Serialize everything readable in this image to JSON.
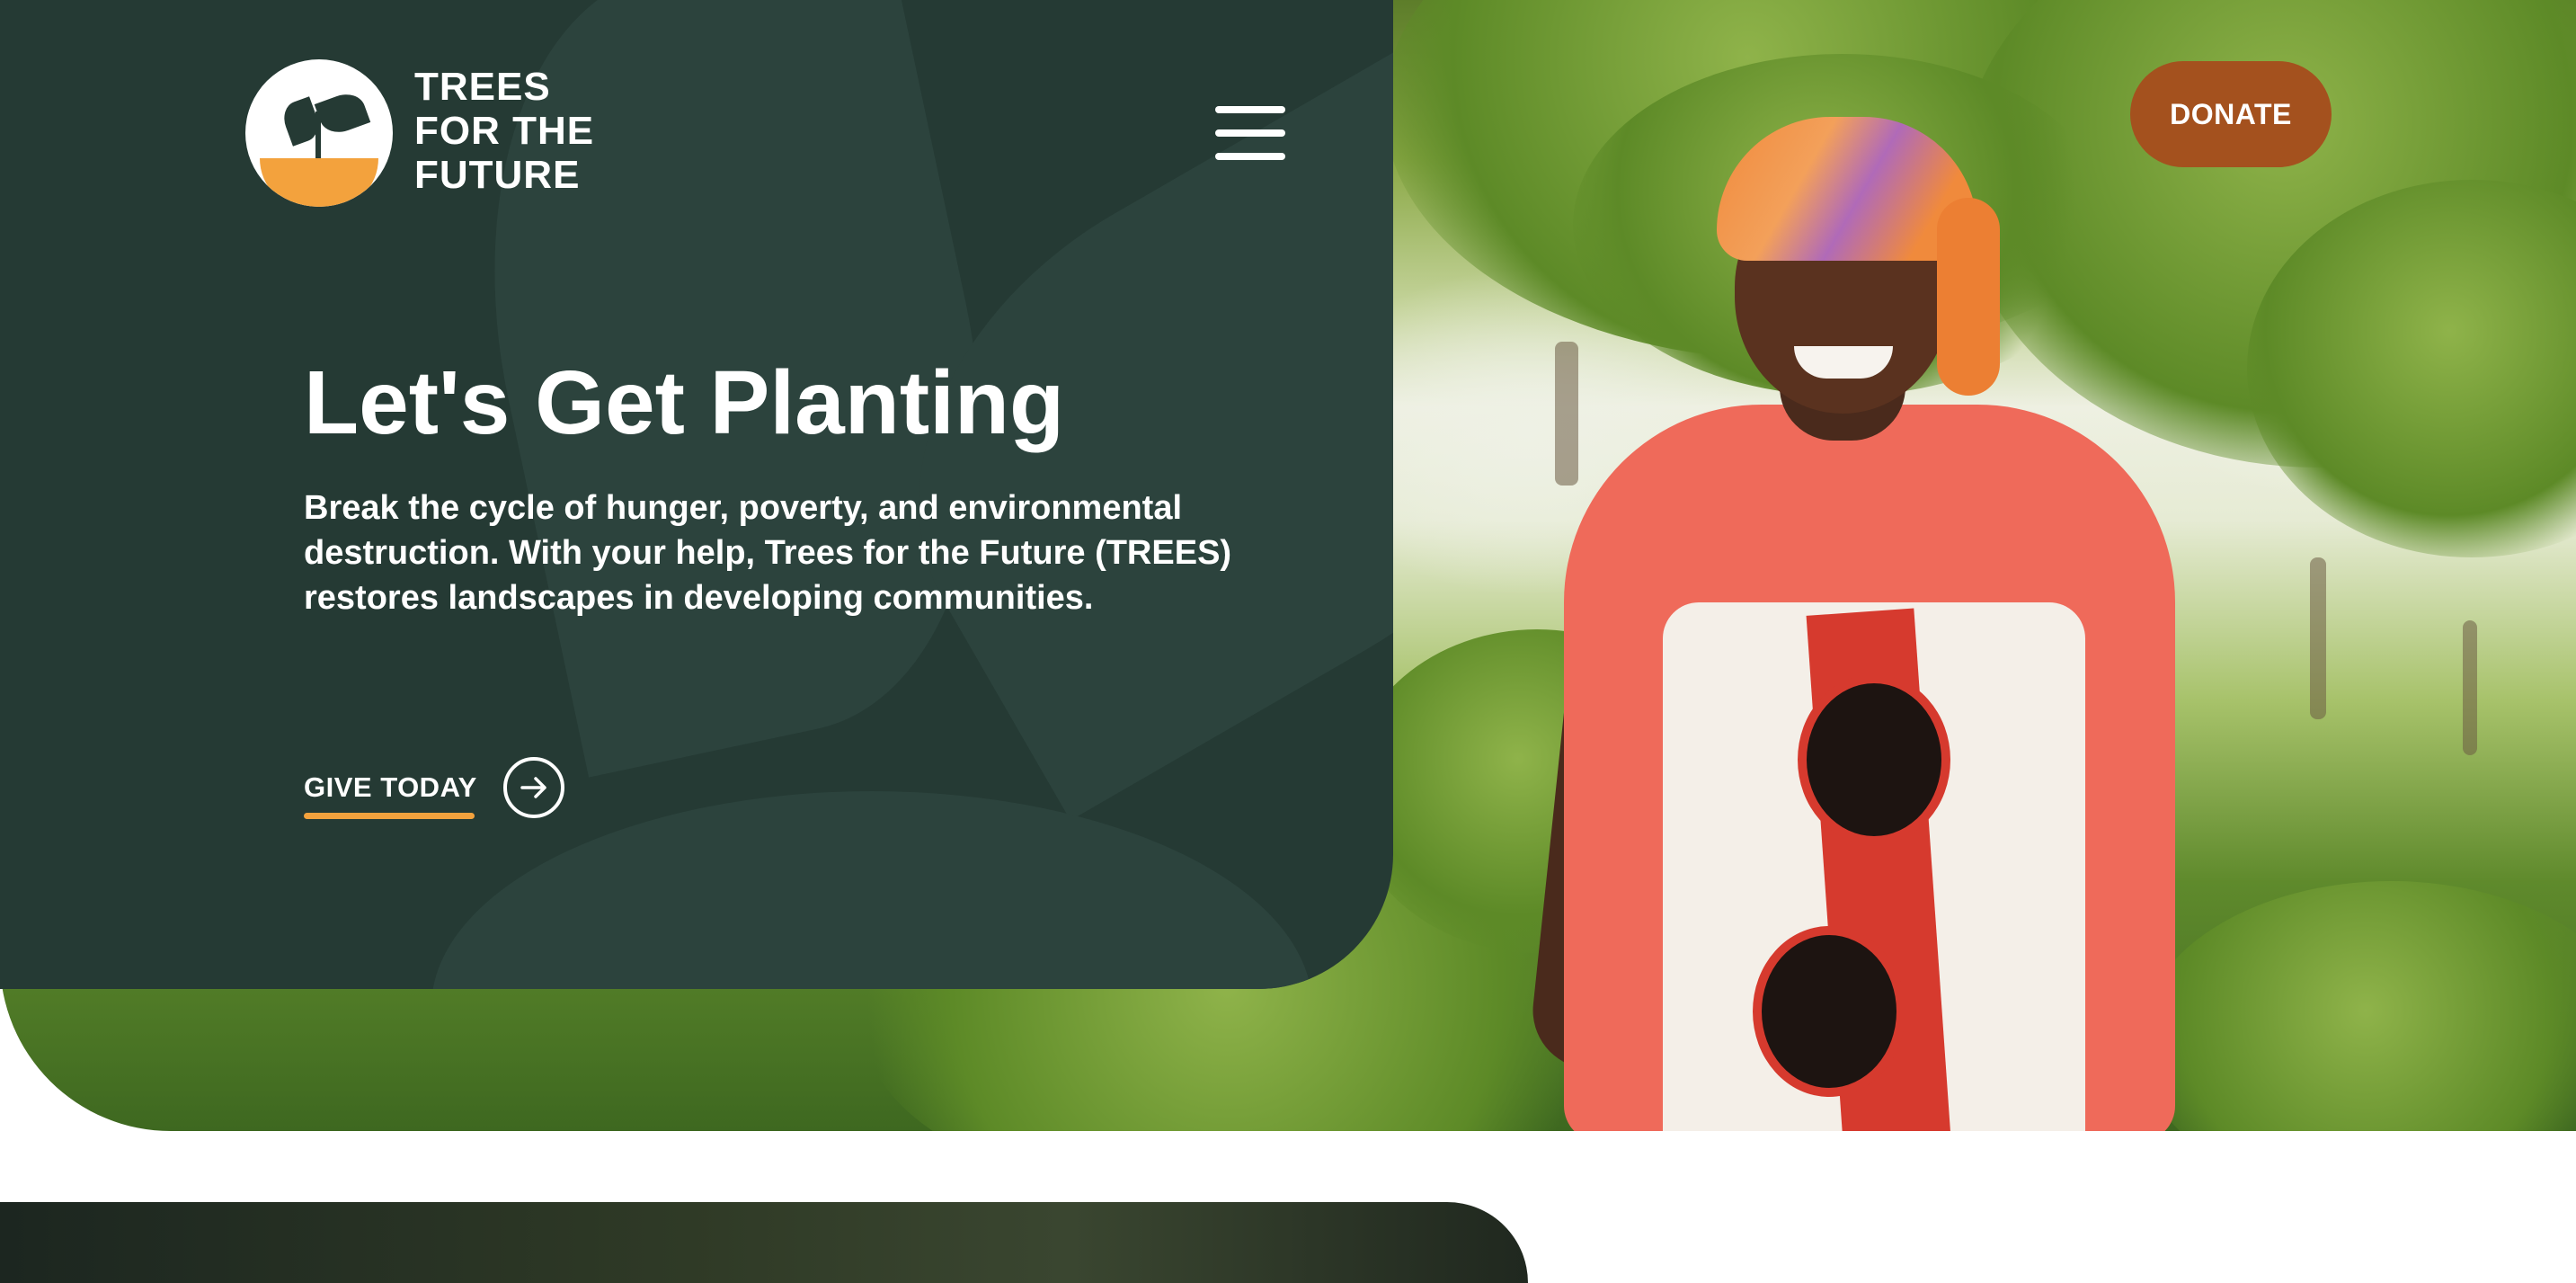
{
  "brand": {
    "name_lines": [
      "TREES",
      "FOR THE",
      "FUTURE"
    ]
  },
  "header": {
    "menu_icon": "hamburger-menu-icon",
    "donate_label": "DONATE"
  },
  "hero": {
    "title": "Let's Get Planting",
    "description": "Break the cycle of hunger, poverty, and environmental destruction. With your help, Trees for the Future (TREES) restores landscapes in developing communities.",
    "cta_label": "GIVE TODAY",
    "cta_icon": "arrow-right-circle-icon"
  },
  "colors": {
    "panel": "#253a34",
    "accent_orange": "#f3a23d",
    "donate_button": "#a4511e",
    "text_light": "#ffffff"
  }
}
